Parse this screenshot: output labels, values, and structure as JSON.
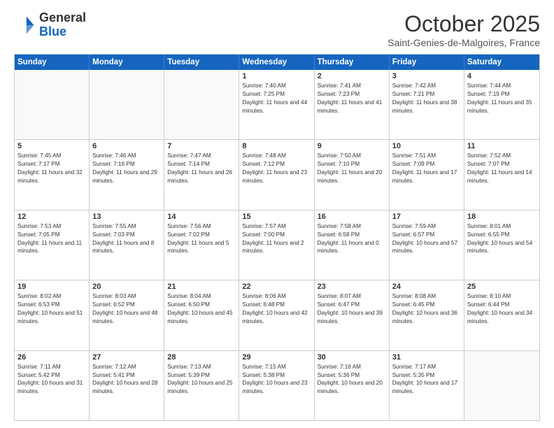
{
  "logo": {
    "general": "General",
    "blue": "Blue"
  },
  "header": {
    "month": "October 2025",
    "location": "Saint-Genies-de-Malgoires, France"
  },
  "days_of_week": [
    "Sunday",
    "Monday",
    "Tuesday",
    "Wednesday",
    "Thursday",
    "Friday",
    "Saturday"
  ],
  "weeks": [
    [
      {
        "day": "",
        "info": ""
      },
      {
        "day": "",
        "info": ""
      },
      {
        "day": "",
        "info": ""
      },
      {
        "day": "1",
        "info": "Sunrise: 7:40 AM\nSunset: 7:25 PM\nDaylight: 11 hours and 44 minutes."
      },
      {
        "day": "2",
        "info": "Sunrise: 7:41 AM\nSunset: 7:23 PM\nDaylight: 11 hours and 41 minutes."
      },
      {
        "day": "3",
        "info": "Sunrise: 7:42 AM\nSunset: 7:21 PM\nDaylight: 11 hours and 38 minutes."
      },
      {
        "day": "4",
        "info": "Sunrise: 7:44 AM\nSunset: 7:19 PM\nDaylight: 11 hours and 35 minutes."
      }
    ],
    [
      {
        "day": "5",
        "info": "Sunrise: 7:45 AM\nSunset: 7:17 PM\nDaylight: 11 hours and 32 minutes."
      },
      {
        "day": "6",
        "info": "Sunrise: 7:46 AM\nSunset: 7:16 PM\nDaylight: 11 hours and 29 minutes."
      },
      {
        "day": "7",
        "info": "Sunrise: 7:47 AM\nSunset: 7:14 PM\nDaylight: 11 hours and 26 minutes."
      },
      {
        "day": "8",
        "info": "Sunrise: 7:48 AM\nSunset: 7:12 PM\nDaylight: 11 hours and 23 minutes."
      },
      {
        "day": "9",
        "info": "Sunrise: 7:50 AM\nSunset: 7:10 PM\nDaylight: 11 hours and 20 minutes."
      },
      {
        "day": "10",
        "info": "Sunrise: 7:51 AM\nSunset: 7:09 PM\nDaylight: 11 hours and 17 minutes."
      },
      {
        "day": "11",
        "info": "Sunrise: 7:52 AM\nSunset: 7:07 PM\nDaylight: 11 hours and 14 minutes."
      }
    ],
    [
      {
        "day": "12",
        "info": "Sunrise: 7:53 AM\nSunset: 7:05 PM\nDaylight: 11 hours and 11 minutes."
      },
      {
        "day": "13",
        "info": "Sunrise: 7:55 AM\nSunset: 7:03 PM\nDaylight: 11 hours and 8 minutes."
      },
      {
        "day": "14",
        "info": "Sunrise: 7:56 AM\nSunset: 7:02 PM\nDaylight: 11 hours and 5 minutes."
      },
      {
        "day": "15",
        "info": "Sunrise: 7:57 AM\nSunset: 7:00 PM\nDaylight: 11 hours and 2 minutes."
      },
      {
        "day": "16",
        "info": "Sunrise: 7:58 AM\nSunset: 6:58 PM\nDaylight: 11 hours and 0 minutes."
      },
      {
        "day": "17",
        "info": "Sunrise: 7:59 AM\nSunset: 6:57 PM\nDaylight: 10 hours and 57 minutes."
      },
      {
        "day": "18",
        "info": "Sunrise: 8:01 AM\nSunset: 6:55 PM\nDaylight: 10 hours and 54 minutes."
      }
    ],
    [
      {
        "day": "19",
        "info": "Sunrise: 8:02 AM\nSunset: 6:53 PM\nDaylight: 10 hours and 51 minutes."
      },
      {
        "day": "20",
        "info": "Sunrise: 8:03 AM\nSunset: 6:52 PM\nDaylight: 10 hours and 48 minutes."
      },
      {
        "day": "21",
        "info": "Sunrise: 8:04 AM\nSunset: 6:50 PM\nDaylight: 10 hours and 45 minutes."
      },
      {
        "day": "22",
        "info": "Sunrise: 8:06 AM\nSunset: 6:48 PM\nDaylight: 10 hours and 42 minutes."
      },
      {
        "day": "23",
        "info": "Sunrise: 8:07 AM\nSunset: 6:47 PM\nDaylight: 10 hours and 39 minutes."
      },
      {
        "day": "24",
        "info": "Sunrise: 8:08 AM\nSunset: 6:45 PM\nDaylight: 10 hours and 36 minutes."
      },
      {
        "day": "25",
        "info": "Sunrise: 8:10 AM\nSunset: 6:44 PM\nDaylight: 10 hours and 34 minutes."
      }
    ],
    [
      {
        "day": "26",
        "info": "Sunrise: 7:11 AM\nSunset: 5:42 PM\nDaylight: 10 hours and 31 minutes."
      },
      {
        "day": "27",
        "info": "Sunrise: 7:12 AM\nSunset: 5:41 PM\nDaylight: 10 hours and 28 minutes."
      },
      {
        "day": "28",
        "info": "Sunrise: 7:13 AM\nSunset: 5:39 PM\nDaylight: 10 hours and 25 minutes."
      },
      {
        "day": "29",
        "info": "Sunrise: 7:15 AM\nSunset: 5:38 PM\nDaylight: 10 hours and 23 minutes."
      },
      {
        "day": "30",
        "info": "Sunrise: 7:16 AM\nSunset: 5:36 PM\nDaylight: 10 hours and 20 minutes."
      },
      {
        "day": "31",
        "info": "Sunrise: 7:17 AM\nSunset: 5:35 PM\nDaylight: 10 hours and 17 minutes."
      },
      {
        "day": "",
        "info": ""
      }
    ]
  ]
}
